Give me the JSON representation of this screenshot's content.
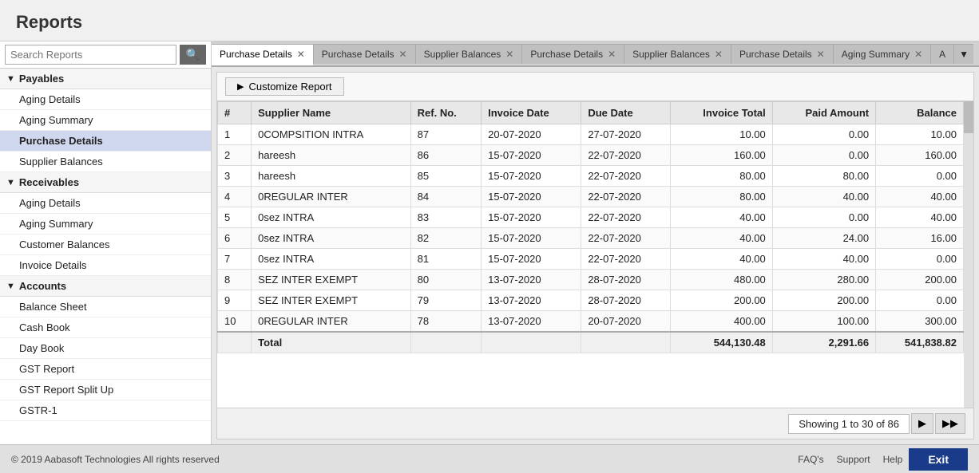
{
  "app": {
    "title": "Reports",
    "footer_copyright": "© 2019 Aabasoft Technologies All rights reserved"
  },
  "sidebar": {
    "search_placeholder": "Search Reports",
    "search_icon": "🔍",
    "sections": [
      {
        "id": "payables",
        "label": "Payables",
        "expanded": true,
        "items": [
          {
            "id": "aging-details-payables",
            "label": "Aging Details",
            "active": false
          },
          {
            "id": "aging-summary-payables",
            "label": "Aging Summary",
            "active": false
          },
          {
            "id": "purchase-details",
            "label": "Purchase Details",
            "active": true
          },
          {
            "id": "supplier-balances",
            "label": "Supplier Balances",
            "active": false
          }
        ]
      },
      {
        "id": "receivables",
        "label": "Receivables",
        "expanded": true,
        "items": [
          {
            "id": "aging-details-receivables",
            "label": "Aging Details",
            "active": false
          },
          {
            "id": "aging-summary-receivables",
            "label": "Aging Summary",
            "active": false
          },
          {
            "id": "customer-balances",
            "label": "Customer Balances",
            "active": false
          },
          {
            "id": "invoice-details",
            "label": "Invoice Details",
            "active": false
          }
        ]
      },
      {
        "id": "accounts",
        "label": "Accounts",
        "expanded": true,
        "items": [
          {
            "id": "balance-sheet",
            "label": "Balance Sheet",
            "active": false
          },
          {
            "id": "cash-book",
            "label": "Cash Book",
            "active": false
          },
          {
            "id": "day-book",
            "label": "Day Book",
            "active": false
          },
          {
            "id": "gst-report",
            "label": "GST Report",
            "active": false
          },
          {
            "id": "gst-report-split-up",
            "label": "GST Report Split Up",
            "active": false
          },
          {
            "id": "gstr-1",
            "label": "GSTR-1",
            "active": false
          }
        ]
      }
    ]
  },
  "tabs": [
    {
      "id": "tab1",
      "label": "Purchase Details",
      "active": true,
      "closable": true
    },
    {
      "id": "tab2",
      "label": "Purchase Details",
      "active": false,
      "closable": true
    },
    {
      "id": "tab3",
      "label": "Supplier Balances",
      "active": false,
      "closable": true
    },
    {
      "id": "tab4",
      "label": "Purchase Details",
      "active": false,
      "closable": true
    },
    {
      "id": "tab5",
      "label": "Supplier Balances",
      "active": false,
      "closable": true
    },
    {
      "id": "tab6",
      "label": "Purchase Details",
      "active": false,
      "closable": true
    },
    {
      "id": "tab7",
      "label": "Aging Summary",
      "active": false,
      "closable": true
    },
    {
      "id": "tab8",
      "label": "A",
      "active": false,
      "closable": false
    }
  ],
  "report": {
    "customize_label": "Customize Report",
    "columns": [
      {
        "id": "num",
        "label": "#",
        "align": "left"
      },
      {
        "id": "supplier_name",
        "label": "Supplier Name",
        "align": "left"
      },
      {
        "id": "ref_no",
        "label": "Ref. No.",
        "align": "left"
      },
      {
        "id": "invoice_date",
        "label": "Invoice Date",
        "align": "left"
      },
      {
        "id": "due_date",
        "label": "Due Date",
        "align": "left"
      },
      {
        "id": "invoice_total",
        "label": "Invoice Total",
        "align": "right"
      },
      {
        "id": "paid_amount",
        "label": "Paid Amount",
        "align": "right"
      },
      {
        "id": "balance",
        "label": "Balance",
        "align": "right"
      }
    ],
    "rows": [
      {
        "num": 1,
        "supplier_name": "0COMPSITION INTRA",
        "ref_no": "87",
        "invoice_date": "20-07-2020",
        "due_date": "27-07-2020",
        "invoice_total": "10.00",
        "paid_amount": "0.00",
        "balance": "10.00"
      },
      {
        "num": 2,
        "supplier_name": "hareesh",
        "ref_no": "86",
        "invoice_date": "15-07-2020",
        "due_date": "22-07-2020",
        "invoice_total": "160.00",
        "paid_amount": "0.00",
        "balance": "160.00"
      },
      {
        "num": 3,
        "supplier_name": "hareesh",
        "ref_no": "85",
        "invoice_date": "15-07-2020",
        "due_date": "22-07-2020",
        "invoice_total": "80.00",
        "paid_amount": "80.00",
        "balance": "0.00"
      },
      {
        "num": 4,
        "supplier_name": "0REGULAR INTER",
        "ref_no": "84",
        "invoice_date": "15-07-2020",
        "due_date": "22-07-2020",
        "invoice_total": "80.00",
        "paid_amount": "40.00",
        "balance": "40.00"
      },
      {
        "num": 5,
        "supplier_name": "0sez INTRA",
        "ref_no": "83",
        "invoice_date": "15-07-2020",
        "due_date": "22-07-2020",
        "invoice_total": "40.00",
        "paid_amount": "0.00",
        "balance": "40.00"
      },
      {
        "num": 6,
        "supplier_name": "0sez INTRA",
        "ref_no": "82",
        "invoice_date": "15-07-2020",
        "due_date": "22-07-2020",
        "invoice_total": "40.00",
        "paid_amount": "24.00",
        "balance": "16.00"
      },
      {
        "num": 7,
        "supplier_name": "0sez INTRA",
        "ref_no": "81",
        "invoice_date": "15-07-2020",
        "due_date": "22-07-2020",
        "invoice_total": "40.00",
        "paid_amount": "40.00",
        "balance": "0.00"
      },
      {
        "num": 8,
        "supplier_name": "SEZ INTER EXEMPT",
        "ref_no": "80",
        "invoice_date": "13-07-2020",
        "due_date": "28-07-2020",
        "invoice_total": "480.00",
        "paid_amount": "280.00",
        "balance": "200.00"
      },
      {
        "num": 9,
        "supplier_name": "SEZ INTER EXEMPT",
        "ref_no": "79",
        "invoice_date": "13-07-2020",
        "due_date": "28-07-2020",
        "invoice_total": "200.00",
        "paid_amount": "200.00",
        "balance": "0.00"
      },
      {
        "num": 10,
        "supplier_name": "0REGULAR INTER",
        "ref_no": "78",
        "invoice_date": "13-07-2020",
        "due_date": "20-07-2020",
        "invoice_total": "400.00",
        "paid_amount": "100.00",
        "balance": "300.00"
      }
    ],
    "total": {
      "label": "Total",
      "invoice_total": "544,130.48",
      "paid_amount": "2,291.66",
      "balance": "541,838.82"
    }
  },
  "pagination": {
    "text": "Showing 1 to 30 of 86",
    "next_icon": "▶",
    "last_icon": "▶▶"
  },
  "footer": {
    "links": [
      "FAQ's",
      "Support",
      "Help"
    ],
    "exit_label": "Exit"
  }
}
